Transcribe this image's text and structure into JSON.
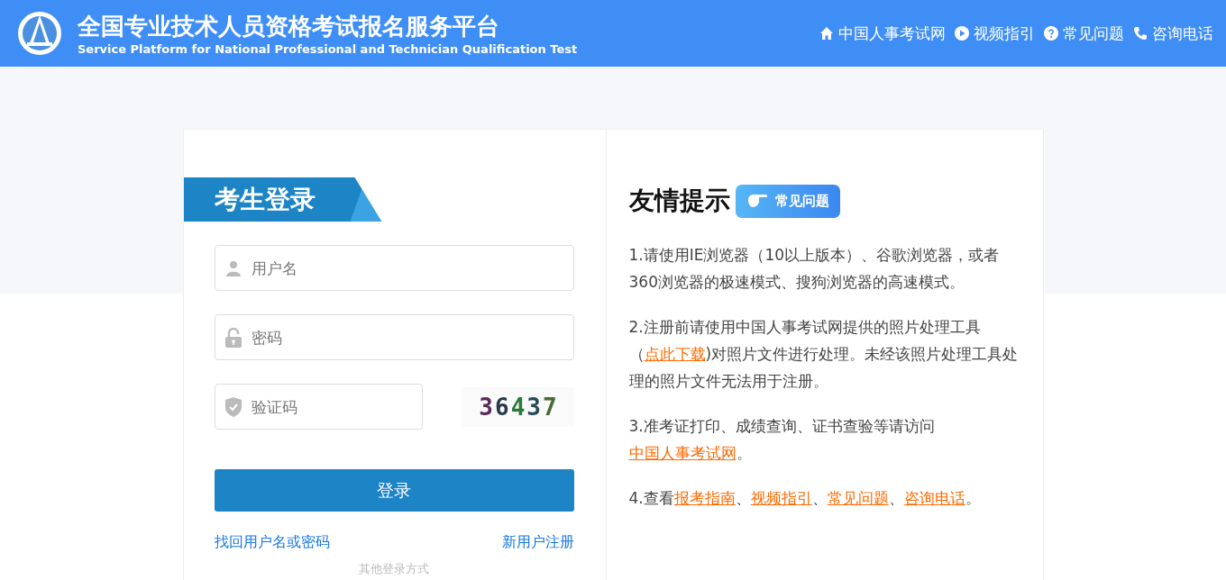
{
  "header": {
    "title": "全国专业技术人员资格考试报名服务平台",
    "subtitle": "Service Platform for National Professional and Technician Qualification Test",
    "nav": [
      {
        "kind": "home",
        "label": "中国人事考试网"
      },
      {
        "kind": "play",
        "label": "视频指引"
      },
      {
        "kind": "help",
        "label": "常见问题"
      },
      {
        "kind": "phone",
        "label": "咨询电话"
      }
    ]
  },
  "login": {
    "title": "考生登录",
    "fields": [
      {
        "kind": "user",
        "placeholder": "用户名"
      },
      {
        "kind": "lock",
        "placeholder": "密码"
      },
      {
        "kind": "shield",
        "placeholder": "验证码"
      }
    ],
    "captcha": "36437",
    "button": "登录",
    "links": [
      "找回用户名或密码",
      "新用户注册"
    ],
    "other": "其他登录方式"
  },
  "tips": {
    "title": "友情提示",
    "badge": "常见问题",
    "items": [
      [
        {
          "text": "1.请使用IE浏览器（10以上版本）、谷歌浏览器，或者360浏览器的极速模式、搜狗浏览器的高速模式。",
          "kind": "text"
        }
      ],
      [
        {
          "text": "2.注册前请使用中国人事考试网提供的照片处理工具（",
          "kind": "text"
        },
        {
          "text": "点此下载",
          "kind": "link"
        },
        {
          "text": ")对照片文件进行处理。未经该照片处理工具处理的照片文件无法用于注册。",
          "kind": "text"
        }
      ],
      [
        {
          "text": "3.准考证打印、成绩查询、证书查验等请访问",
          "kind": "text"
        },
        {
          "text": "中国人事考试网",
          "kind": "link"
        },
        {
          "text": "。",
          "kind": "text"
        }
      ],
      [
        {
          "text": "4.查看",
          "kind": "text"
        },
        {
          "text": "报考指南",
          "kind": "link"
        },
        {
          "text": "、",
          "kind": "text"
        },
        {
          "text": "视频指引",
          "kind": "link"
        },
        {
          "text": "、",
          "kind": "text"
        },
        {
          "text": "常见问题",
          "kind": "link"
        },
        {
          "text": "、",
          "kind": "text"
        },
        {
          "text": "咨询电话",
          "kind": "link"
        },
        {
          "text": "。",
          "kind": "text"
        }
      ]
    ]
  }
}
